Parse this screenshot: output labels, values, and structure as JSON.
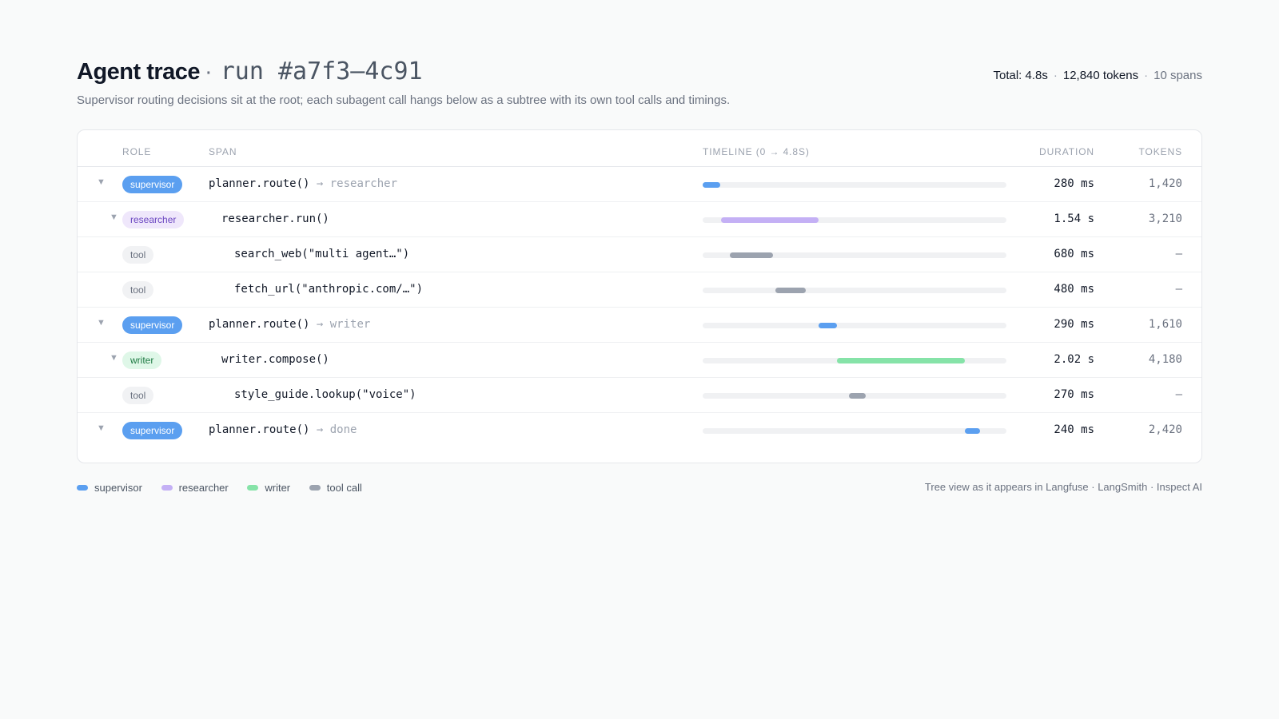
{
  "header": {
    "title": "Agent trace",
    "title_sep": "·",
    "run_id": "run #a7f3–4c91",
    "subtitle": "Supervisor routing decisions sit at the root; each subagent call hangs below as a subtree with its own tool calls and timings.",
    "stats": {
      "total": "Total: 4.8s",
      "tokens": "12,840 tokens",
      "spans": "10 spans",
      "sep": "·"
    }
  },
  "table": {
    "columns": {
      "role": "ROLE",
      "span": "SPAN",
      "timeline": "TIMELINE (0 → 4.8S)",
      "duration": "DURATION",
      "tokens": "TOKENS"
    },
    "timeline_total_s": 4.8,
    "rows": [
      {
        "role": "supervisor",
        "span": "planner.route()",
        "target": "→ researcher",
        "duration": "280 ms",
        "tokens": "1,420",
        "depth": 0,
        "expandable": true,
        "start_s": 0.0,
        "length_s": 0.28
      },
      {
        "role": "researcher",
        "span": "researcher.run()",
        "target": "",
        "duration": "1.54 s",
        "tokens": "3,210",
        "depth": 1,
        "expandable": true,
        "start_s": 0.29,
        "length_s": 1.54
      },
      {
        "role": "tool",
        "span": "search_web(\"multi agent…\")",
        "target": "",
        "duration": "680 ms",
        "tokens": "—",
        "depth": 2,
        "expandable": false,
        "start_s": 0.43,
        "length_s": 0.68
      },
      {
        "role": "tool",
        "span": "fetch_url(\"anthropic.com/…\")",
        "target": "",
        "duration": "480 ms",
        "tokens": "—",
        "depth": 2,
        "expandable": false,
        "start_s": 1.15,
        "length_s": 0.48
      },
      {
        "role": "supervisor",
        "span": "planner.route()",
        "target": "→ writer",
        "duration": "290 ms",
        "tokens": "1,610",
        "depth": 0,
        "expandable": true,
        "start_s": 1.83,
        "length_s": 0.29
      },
      {
        "role": "writer",
        "span": "writer.compose()",
        "target": "",
        "duration": "2.02 s",
        "tokens": "4,180",
        "depth": 1,
        "expandable": true,
        "start_s": 2.12,
        "length_s": 2.02
      },
      {
        "role": "tool",
        "span": "style_guide.lookup(\"voice\")",
        "target": "",
        "duration": "270 ms",
        "tokens": "—",
        "depth": 2,
        "expandable": false,
        "start_s": 2.31,
        "length_s": 0.27
      },
      {
        "role": "supervisor",
        "span": "planner.route()",
        "target": "→ done",
        "duration": "240 ms",
        "tokens": "2,420",
        "depth": 0,
        "expandable": true,
        "start_s": 4.14,
        "length_s": 0.24
      }
    ]
  },
  "legend": [
    {
      "label": "supervisor",
      "color": "#5b9ff0"
    },
    {
      "label": "researcher",
      "color": "#c4b0f5"
    },
    {
      "label": "writer",
      "color": "#86e3a8"
    },
    {
      "label": "tool call",
      "color": "#9ca3af"
    }
  ],
  "colors": {
    "supervisor": "#5b9ff0",
    "researcher": "#c4b0f5",
    "writer": "#86e3a8",
    "tool": "#9ca3af"
  },
  "icons": {
    "expand": "chevron-down-icon",
    "caret_glyph": "▼"
  },
  "footnote": "Tree view as it appears in Langfuse · LangSmith · Inspect AI"
}
